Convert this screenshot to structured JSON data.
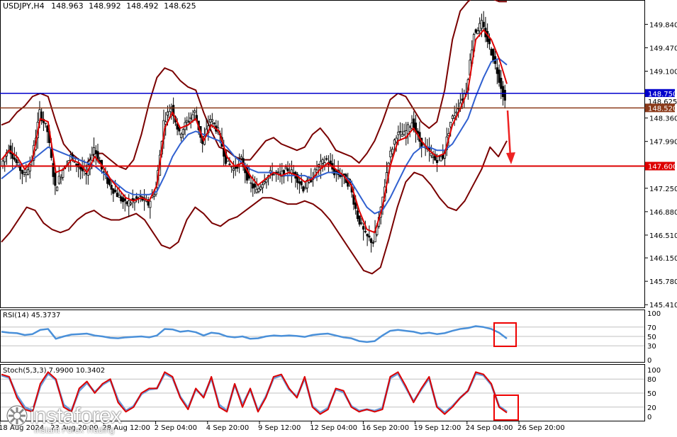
{
  "header": {
    "symbol": "USDJPY,H4",
    "open": "148.963",
    "high": "148.992",
    "low": "148.492",
    "close": "148.625"
  },
  "chart_data": [
    {
      "type": "candlestick",
      "panel": "price",
      "y_ticks": [
        145.41,
        145.78,
        146.15,
        146.51,
        146.88,
        147.25,
        147.6,
        147.99,
        148.36,
        148.75,
        149.1,
        149.47,
        149.84
      ],
      "y_tick_labels": [
        "145.410",
        "145.780",
        "146.150",
        "146.510",
        "146.880",
        "147.250",
        "147.990",
        "148.360",
        "149.100",
        "149.470",
        "149.840"
      ],
      "ylim": [
        145.39,
        150.18
      ],
      "horizontal_levels": [
        {
          "value": 148.75,
          "label": "148.750",
          "color": "#0000cc"
        },
        {
          "value": 148.625,
          "label": "148.625",
          "color": "#000000"
        },
        {
          "value": 148.52,
          "label": "148.520",
          "color": "#8b3a1a"
        },
        {
          "value": 147.6,
          "label": "147.600",
          "color": "#dd0000"
        }
      ],
      "close_path": [
        147.6,
        147.9,
        147.65,
        147.45,
        147.7,
        148.45,
        148.15,
        147.25,
        147.55,
        147.75,
        147.6,
        147.45,
        147.9,
        147.55,
        147.3,
        147.15,
        147.0,
        147.05,
        147.1,
        147.0,
        147.25,
        148.3,
        148.55,
        148.1,
        148.3,
        148.45,
        147.95,
        148.35,
        148.15,
        147.7,
        147.55,
        147.7,
        147.35,
        147.2,
        147.4,
        147.5,
        147.45,
        147.55,
        147.45,
        147.25,
        147.4,
        147.6,
        147.7,
        147.5,
        147.45,
        147.3,
        146.8,
        146.5,
        146.4,
        146.9,
        147.7,
        148.1,
        148.1,
        148.3,
        148.0,
        147.85,
        147.7,
        147.75,
        148.3,
        148.55,
        148.8,
        149.7,
        149.85,
        149.5,
        149.1,
        148.625
      ],
      "bollinger_upper": [
        148.25,
        148.3,
        148.45,
        148.55,
        148.7,
        148.75,
        148.7,
        148.3,
        147.95,
        147.8,
        147.7,
        147.65,
        147.8,
        147.8,
        147.7,
        147.6,
        147.55,
        147.7,
        148.1,
        148.6,
        149.0,
        149.15,
        149.1,
        148.95,
        148.85,
        148.8,
        148.45,
        148.15,
        147.9,
        147.85,
        147.75,
        147.7,
        147.7,
        147.85,
        148.0,
        148.05,
        147.95,
        147.9,
        147.85,
        147.9,
        148.1,
        148.2,
        148.05,
        147.85,
        147.8,
        147.75,
        147.65,
        147.8,
        148.0,
        148.3,
        148.65,
        148.75,
        148.7,
        148.5,
        148.3,
        148.2,
        148.3,
        148.8,
        149.6,
        150.05,
        150.2,
        150.3,
        150.3,
        150.25,
        150.2,
        150.2
      ],
      "bollinger_lower": [
        146.4,
        146.55,
        146.75,
        146.95,
        146.9,
        146.7,
        146.6,
        146.55,
        146.6,
        146.75,
        146.85,
        146.9,
        146.8,
        146.75,
        146.75,
        146.8,
        146.85,
        146.75,
        146.55,
        146.35,
        146.3,
        146.4,
        146.75,
        146.95,
        146.85,
        146.7,
        146.65,
        146.75,
        146.8,
        146.9,
        147.0,
        147.1,
        147.1,
        147.05,
        147.0,
        147.0,
        147.05,
        147.0,
        146.9,
        146.75,
        146.55,
        146.35,
        146.15,
        145.95,
        145.9,
        146.0,
        146.45,
        146.95,
        147.35,
        147.5,
        147.45,
        147.3,
        147.1,
        146.95,
        146.9,
        147.05,
        147.3,
        147.55,
        147.9,
        147.75,
        148.0
      ],
      "ma_red": [
        147.7,
        147.85,
        147.75,
        147.55,
        147.7,
        148.35,
        148.3,
        147.5,
        147.55,
        147.7,
        147.65,
        147.5,
        147.75,
        147.6,
        147.4,
        147.25,
        147.1,
        147.05,
        147.1,
        147.05,
        147.3,
        148.2,
        148.45,
        148.2,
        148.25,
        148.35,
        148.0,
        148.25,
        148.15,
        147.75,
        147.6,
        147.65,
        147.45,
        147.3,
        147.4,
        147.5,
        147.45,
        147.5,
        147.45,
        147.35,
        147.4,
        147.55,
        147.65,
        147.55,
        147.45,
        147.3,
        146.9,
        146.6,
        146.55,
        146.95,
        147.6,
        148.0,
        148.05,
        148.2,
        148.0,
        147.85,
        147.75,
        147.8,
        148.25,
        148.5,
        148.8,
        149.6,
        149.75,
        149.6,
        149.3,
        148.9
      ],
      "ma_blue": [
        147.4,
        147.5,
        147.6,
        147.65,
        147.7,
        147.8,
        147.9,
        147.85,
        147.8,
        147.75,
        147.7,
        147.65,
        147.6,
        147.5,
        147.4,
        147.3,
        147.2,
        147.15,
        147.15,
        147.15,
        147.2,
        147.45,
        147.75,
        147.95,
        148.1,
        148.15,
        148.1,
        148.05,
        148.0,
        147.9,
        147.75,
        147.65,
        147.55,
        147.5,
        147.5,
        147.5,
        147.45,
        147.45,
        147.45,
        147.45,
        147.4,
        147.45,
        147.5,
        147.5,
        147.45,
        147.35,
        147.15,
        146.95,
        146.85,
        146.9,
        147.1,
        147.35,
        147.6,
        147.8,
        147.9,
        147.9,
        147.85,
        147.85,
        147.95,
        148.15,
        148.35,
        148.7,
        149.0,
        149.25,
        149.3,
        149.2
      ]
    },
    {
      "type": "line",
      "panel": "rsi",
      "title": "RSI(14) 45.3737",
      "y_ticks": [
        0,
        30,
        50,
        70,
        100
      ],
      "ylim": [
        0,
        100
      ],
      "values": [
        60,
        58,
        57,
        53,
        55,
        64,
        66,
        45,
        50,
        54,
        55,
        56,
        52,
        50,
        47,
        46,
        48,
        49,
        50,
        48,
        52,
        66,
        65,
        60,
        62,
        59,
        52,
        58,
        56,
        50,
        48,
        50,
        45,
        46,
        50,
        52,
        51,
        52,
        51,
        49,
        53,
        55,
        56,
        52,
        48,
        46,
        40,
        38,
        40,
        52,
        62,
        64,
        62,
        60,
        56,
        58,
        55,
        57,
        62,
        66,
        68,
        72,
        70,
        66,
        58,
        45.37
      ]
    },
    {
      "type": "line",
      "panel": "stochastic",
      "title": "Stoch(5,3,3) 7.9900 10.3402",
      "y_ticks": [
        0,
        20,
        50,
        80,
        100
      ],
      "ylim": [
        0,
        100
      ],
      "series": [
        {
          "values": [
            90,
            85,
            40,
            15,
            10,
            70,
            95,
            80,
            20,
            10,
            60,
            75,
            50,
            70,
            80,
            30,
            10,
            20,
            50,
            60,
            60,
            95,
            85,
            40,
            15,
            60,
            40,
            85,
            20,
            10,
            70,
            20,
            60,
            10,
            40,
            85,
            90,
            60,
            40,
            85,
            20,
            5,
            15,
            60,
            55,
            20,
            10,
            15,
            10,
            15,
            85,
            95,
            65,
            30,
            60,
            85,
            20,
            5,
            20,
            40,
            55,
            95,
            90,
            70,
            20,
            8
          ]
        },
        {
          "values": [
            88,
            83,
            45,
            20,
            12,
            65,
            92,
            78,
            25,
            12,
            55,
            72,
            52,
            68,
            78,
            35,
            12,
            22,
            48,
            58,
            60,
            92,
            83,
            42,
            18,
            58,
            42,
            82,
            25,
            12,
            68,
            25,
            58,
            12,
            42,
            82,
            88,
            58,
            42,
            82,
            22,
            8,
            18,
            58,
            52,
            22,
            12,
            15,
            12,
            18,
            82,
            92,
            62,
            32,
            58,
            82,
            22,
            8,
            22,
            40,
            55,
            92,
            88,
            68,
            22,
            10
          ]
        }
      ]
    }
  ],
  "x_axis": {
    "tick_labels": [
      "18 Aug 2024",
      "23 Aug 20:00",
      "28 Aug 12:00",
      "2 Sep 04:00",
      "4 Sep 20:00",
      "9 Sep 12:00",
      "12 Sep 04:00",
      "16 Sep 20:00",
      "19 Sep 12:00",
      "24 Sep 04:00",
      "26 Sep 20:00"
    ]
  },
  "logo": {
    "name": "instaforex",
    "tagline": "Instant Forex Trading"
  },
  "colors": {
    "background": "#ffffff",
    "candle": "#000000",
    "bollinger": "#7a0000",
    "ma_fast": "#dd0000",
    "ma_slow": "#3060d0",
    "rsi": "#4a90d9",
    "stoch_main": "#dd0000",
    "stoch_signal": "#6a9ad8",
    "arrow": "#ee2222",
    "highlight_box": "#ee0000"
  }
}
